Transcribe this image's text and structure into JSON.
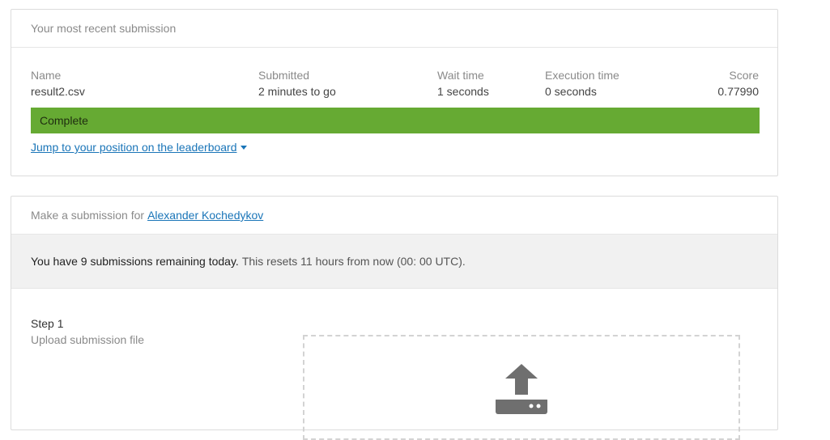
{
  "recent": {
    "header": "Your most recent submission",
    "columns": {
      "name": {
        "label": "Name",
        "value": "result2.csv"
      },
      "submitted": {
        "label": "Submitted",
        "value": "2 minutes to go"
      },
      "wait": {
        "label": "Wait time",
        "value": "1 seconds"
      },
      "execution": {
        "label": "Execution time",
        "value": "0 seconds"
      },
      "score": {
        "label": "Score",
        "value": "0.77990"
      }
    },
    "status": "Complete",
    "status_color": "#66aa33",
    "jump_link": "Jump to your position on the leaderboard"
  },
  "make": {
    "header_prefix": "Make a submission for",
    "user": "Alexander Kochedykov",
    "remaining_strong": "You have 9 submissions remaining today.",
    "remaining_rest": "This resets 11 hours from now (00: 00 UTC).",
    "step_title": "Step 1",
    "step_subtitle": "Upload submission file",
    "upload_icon": "upload-icon"
  },
  "colors": {
    "link": "#1a75b8",
    "complete": "#66aa33"
  }
}
